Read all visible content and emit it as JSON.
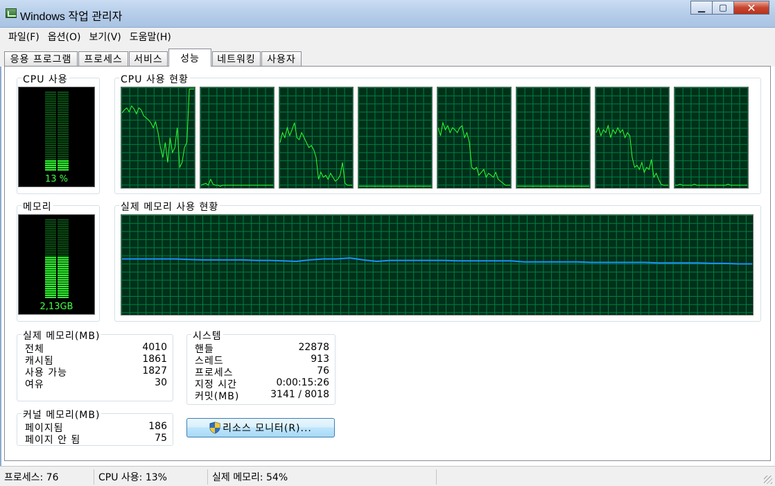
{
  "window": {
    "title": "Windows 작업 관리자"
  },
  "menu": [
    "파일(F)",
    "옵션(O)",
    "보기(V)",
    "도움말(H)"
  ],
  "tabs": [
    "응용 프로그램",
    "프로세스",
    "서비스",
    "성능",
    "네트워킹",
    "사용자"
  ],
  "active_tab": "성능",
  "cpu_usage": {
    "label": "CPU 사용",
    "value_text": "13 %",
    "percent": 13
  },
  "cpu_history": {
    "label": "CPU 사용 현황",
    "cores": 8
  },
  "memory": {
    "label": "메모리",
    "value_text": "2,13GB",
    "percent": 54
  },
  "memory_history": {
    "label": "실제 메모리 사용 현황"
  },
  "physical_memory": {
    "label": "실제 메모리(MB)",
    "rows": [
      {
        "label": "전체",
        "value": "4010"
      },
      {
        "label": "캐시됨",
        "value": "1861"
      },
      {
        "label": "사용 가능",
        "value": "1827"
      },
      {
        "label": "여유",
        "value": "30"
      }
    ]
  },
  "kernel_memory": {
    "label": "커널 메모리(MB)",
    "rows": [
      {
        "label": "페이지됨",
        "value": "186"
      },
      {
        "label": "페이지 안 됨",
        "value": "75"
      }
    ]
  },
  "system": {
    "label": "시스템",
    "rows": [
      {
        "label": "핸들",
        "value": "22878"
      },
      {
        "label": "스레드",
        "value": "913"
      },
      {
        "label": "프로세스",
        "value": "76"
      },
      {
        "label": "지정 시간",
        "value": "0:00:15:26"
      },
      {
        "label": "커밋(MB)",
        "value": "3141 / 8018"
      }
    ]
  },
  "resource_monitor_button": "리소스 모니터(R)...",
  "status": {
    "processes": "프로세스: 76",
    "cpu": "CPU 사용: 13%",
    "memory": "실제 메모리: 54%"
  },
  "colors": {
    "graph_bg": "#00301a",
    "grid": "#00803f",
    "cpu_line": "#33ff33",
    "mem_line": "#1e90ff",
    "meter_on": "#33ff33",
    "meter_off": "#0b4d14"
  }
}
